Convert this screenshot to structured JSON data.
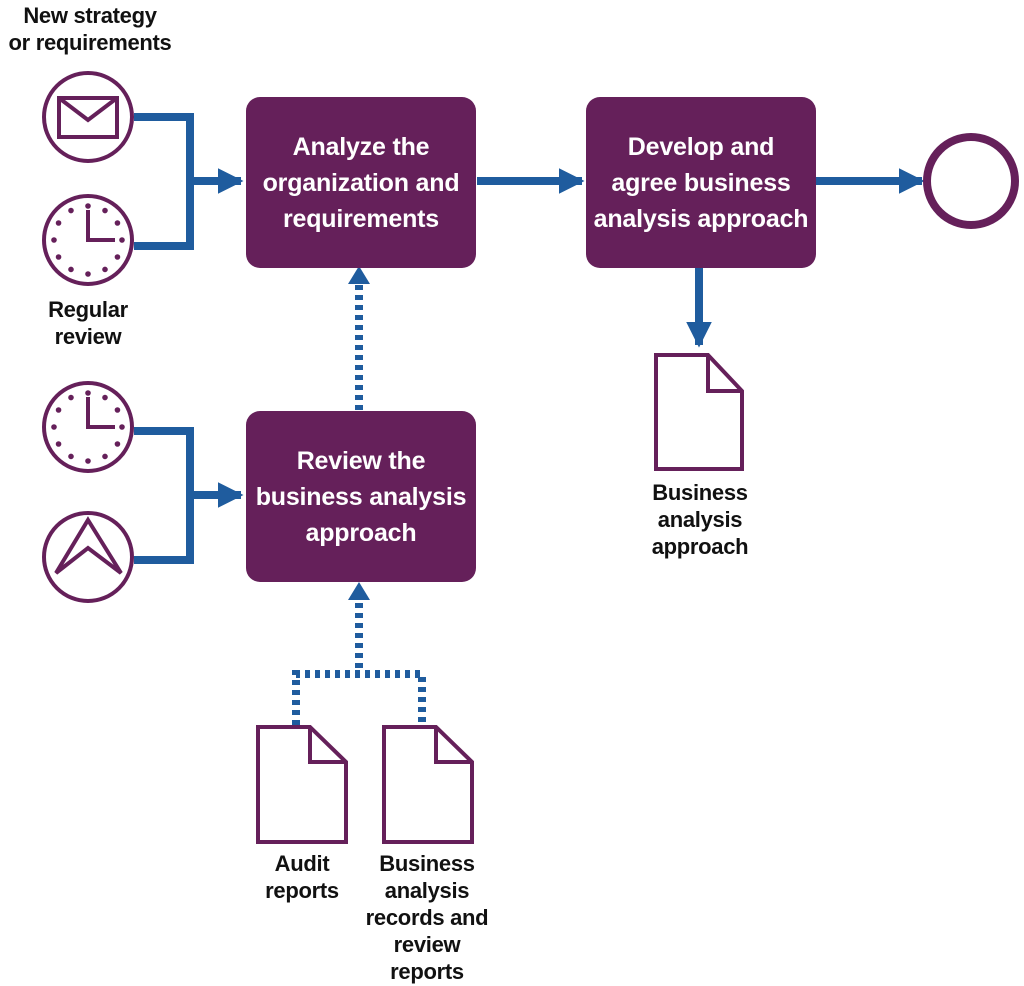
{
  "colors": {
    "process": "#65205a",
    "connector": "#1f5c9e",
    "text": "#111111"
  },
  "processes": [
    {
      "id": "analyze",
      "lines": [
        "Analyze the",
        "organization and",
        "requirements"
      ]
    },
    {
      "id": "develop",
      "lines": [
        "Develop and",
        "agree business",
        "analysis approach"
      ]
    },
    {
      "id": "review",
      "lines": [
        "Review the",
        "business analysis",
        "approach"
      ]
    }
  ],
  "events": {
    "new_strategy": {
      "icon": "envelope-icon",
      "label_lines": [
        "New strategy",
        "or requirements"
      ]
    },
    "regular_review": {
      "icon": "clock-icon",
      "label_lines": [
        "Regular",
        "review"
      ]
    },
    "timer_review": {
      "icon": "clock-icon"
    },
    "escalation": {
      "icon": "escalation-icon"
    },
    "end": {
      "icon": "end-event-circle"
    }
  },
  "artifacts": [
    {
      "id": "ba_approach",
      "label_lines": [
        "Business",
        "analysis",
        "approach"
      ]
    },
    {
      "id": "audit_reports",
      "label_lines": [
        "Audit",
        "reports"
      ]
    },
    {
      "id": "ba_records",
      "label_lines": [
        "Business",
        "analysis",
        "records and",
        "review",
        "reports"
      ]
    }
  ]
}
